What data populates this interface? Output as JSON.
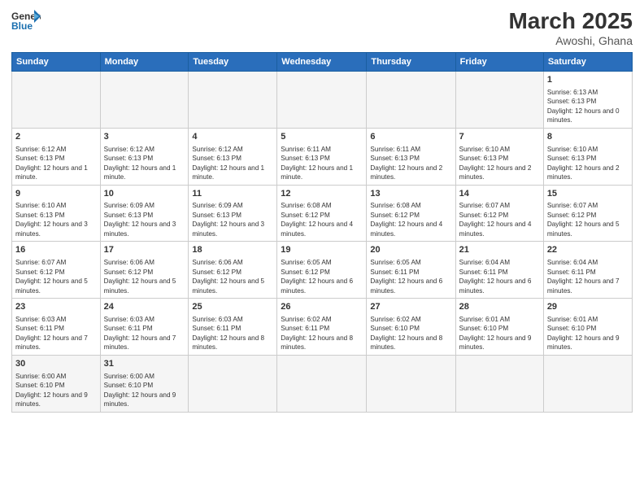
{
  "header": {
    "logo_general": "General",
    "logo_blue": "Blue",
    "month_title": "March 2025",
    "location": "Awoshi, Ghana"
  },
  "weekdays": [
    "Sunday",
    "Monday",
    "Tuesday",
    "Wednesday",
    "Thursday",
    "Friday",
    "Saturday"
  ],
  "weeks": [
    [
      {
        "day": "",
        "info": "",
        "empty": true
      },
      {
        "day": "",
        "info": "",
        "empty": true
      },
      {
        "day": "",
        "info": "",
        "empty": true
      },
      {
        "day": "",
        "info": "",
        "empty": true
      },
      {
        "day": "",
        "info": "",
        "empty": true
      },
      {
        "day": "",
        "info": "",
        "empty": true
      },
      {
        "day": "1",
        "info": "Sunrise: 6:13 AM\nSunset: 6:13 PM\nDaylight: 12 hours and 0 minutes."
      }
    ],
    [
      {
        "day": "2",
        "info": "Sunrise: 6:12 AM\nSunset: 6:13 PM\nDaylight: 12 hours and 1 minute."
      },
      {
        "day": "3",
        "info": "Sunrise: 6:12 AM\nSunset: 6:13 PM\nDaylight: 12 hours and 1 minute."
      },
      {
        "day": "4",
        "info": "Sunrise: 6:12 AM\nSunset: 6:13 PM\nDaylight: 12 hours and 1 minute."
      },
      {
        "day": "5",
        "info": "Sunrise: 6:11 AM\nSunset: 6:13 PM\nDaylight: 12 hours and 1 minute."
      },
      {
        "day": "6",
        "info": "Sunrise: 6:11 AM\nSunset: 6:13 PM\nDaylight: 12 hours and 2 minutes."
      },
      {
        "day": "7",
        "info": "Sunrise: 6:10 AM\nSunset: 6:13 PM\nDaylight: 12 hours and 2 minutes."
      },
      {
        "day": "8",
        "info": "Sunrise: 6:10 AM\nSunset: 6:13 PM\nDaylight: 12 hours and 2 minutes."
      }
    ],
    [
      {
        "day": "9",
        "info": "Sunrise: 6:10 AM\nSunset: 6:13 PM\nDaylight: 12 hours and 3 minutes."
      },
      {
        "day": "10",
        "info": "Sunrise: 6:09 AM\nSunset: 6:13 PM\nDaylight: 12 hours and 3 minutes."
      },
      {
        "day": "11",
        "info": "Sunrise: 6:09 AM\nSunset: 6:13 PM\nDaylight: 12 hours and 3 minutes."
      },
      {
        "day": "12",
        "info": "Sunrise: 6:08 AM\nSunset: 6:12 PM\nDaylight: 12 hours and 4 minutes."
      },
      {
        "day": "13",
        "info": "Sunrise: 6:08 AM\nSunset: 6:12 PM\nDaylight: 12 hours and 4 minutes."
      },
      {
        "day": "14",
        "info": "Sunrise: 6:07 AM\nSunset: 6:12 PM\nDaylight: 12 hours and 4 minutes."
      },
      {
        "day": "15",
        "info": "Sunrise: 6:07 AM\nSunset: 6:12 PM\nDaylight: 12 hours and 5 minutes."
      }
    ],
    [
      {
        "day": "16",
        "info": "Sunrise: 6:07 AM\nSunset: 6:12 PM\nDaylight: 12 hours and 5 minutes."
      },
      {
        "day": "17",
        "info": "Sunrise: 6:06 AM\nSunset: 6:12 PM\nDaylight: 12 hours and 5 minutes."
      },
      {
        "day": "18",
        "info": "Sunrise: 6:06 AM\nSunset: 6:12 PM\nDaylight: 12 hours and 5 minutes."
      },
      {
        "day": "19",
        "info": "Sunrise: 6:05 AM\nSunset: 6:12 PM\nDaylight: 12 hours and 6 minutes."
      },
      {
        "day": "20",
        "info": "Sunrise: 6:05 AM\nSunset: 6:11 PM\nDaylight: 12 hours and 6 minutes."
      },
      {
        "day": "21",
        "info": "Sunrise: 6:04 AM\nSunset: 6:11 PM\nDaylight: 12 hours and 6 minutes."
      },
      {
        "day": "22",
        "info": "Sunrise: 6:04 AM\nSunset: 6:11 PM\nDaylight: 12 hours and 7 minutes."
      }
    ],
    [
      {
        "day": "23",
        "info": "Sunrise: 6:03 AM\nSunset: 6:11 PM\nDaylight: 12 hours and 7 minutes."
      },
      {
        "day": "24",
        "info": "Sunrise: 6:03 AM\nSunset: 6:11 PM\nDaylight: 12 hours and 7 minutes."
      },
      {
        "day": "25",
        "info": "Sunrise: 6:03 AM\nSunset: 6:11 PM\nDaylight: 12 hours and 8 minutes."
      },
      {
        "day": "26",
        "info": "Sunrise: 6:02 AM\nSunset: 6:11 PM\nDaylight: 12 hours and 8 minutes."
      },
      {
        "day": "27",
        "info": "Sunrise: 6:02 AM\nSunset: 6:10 PM\nDaylight: 12 hours and 8 minutes."
      },
      {
        "day": "28",
        "info": "Sunrise: 6:01 AM\nSunset: 6:10 PM\nDaylight: 12 hours and 9 minutes."
      },
      {
        "day": "29",
        "info": "Sunrise: 6:01 AM\nSunset: 6:10 PM\nDaylight: 12 hours and 9 minutes."
      }
    ],
    [
      {
        "day": "30",
        "info": "Sunrise: 6:00 AM\nSunset: 6:10 PM\nDaylight: 12 hours and 9 minutes.",
        "last": true
      },
      {
        "day": "31",
        "info": "Sunrise: 6:00 AM\nSunset: 6:10 PM\nDaylight: 12 hours and 9 minutes.",
        "last": true
      },
      {
        "day": "",
        "info": "",
        "empty": true,
        "last": true
      },
      {
        "day": "",
        "info": "",
        "empty": true,
        "last": true
      },
      {
        "day": "",
        "info": "",
        "empty": true,
        "last": true
      },
      {
        "day": "",
        "info": "",
        "empty": true,
        "last": true
      },
      {
        "day": "",
        "info": "",
        "empty": true,
        "last": true
      }
    ]
  ]
}
